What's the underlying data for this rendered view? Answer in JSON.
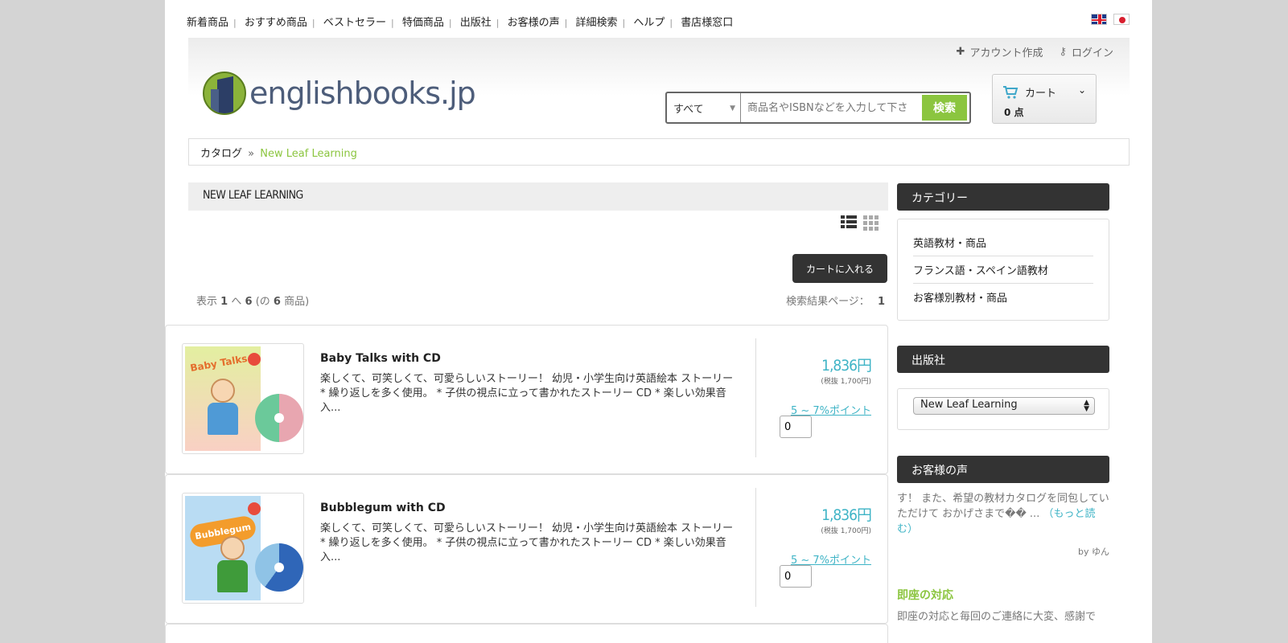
{
  "topnav": [
    "新着商品",
    "おすすめ商品",
    "ベストセラー",
    "特価商品",
    "出版社",
    "お客様の声",
    "詳細検索",
    "ヘルプ",
    "書店様窓口"
  ],
  "account": {
    "create": "アカウント作成",
    "login": "ログイン"
  },
  "logo": {
    "text": "englishbooks.jp"
  },
  "search": {
    "category": "すべて",
    "placeholder": "商品名やISBNなどを入力して下さ",
    "button": "検索"
  },
  "cart": {
    "label": "カート",
    "count": "0 点"
  },
  "breadcrumb": {
    "root": "カタログ",
    "sep": "»",
    "current": "New Leaf Learning"
  },
  "page_title": "NEW LEAF LEARNING",
  "add_to_cart": "カートに入れる",
  "results": {
    "prefix": "表示",
    "from": "1",
    "to_word": "へ",
    "to": "6",
    "of_open": "(の",
    "total": "6",
    "of_close": "商品)",
    "page_label": "検索結果ページ：",
    "page": "1"
  },
  "products": [
    {
      "name": "Baby Talks with CD",
      "cover_title": "Baby Talks",
      "desc": "楽しくて、可笑しくて、可愛らしいストーリー！ 幼児・小学生向け英語絵本 ストーリー * 繰り返しを多く使用。 * 子供の視点に立って書かれたストーリー CD * 楽しい効果音入...",
      "price": "1,836円",
      "price_tax": "(税抜 1,700円)",
      "points": "5 ~ 7%ポイント",
      "qty": "0"
    },
    {
      "name": "Bubblegum with CD",
      "cover_title": "Bubblegum",
      "desc": "楽しくて、可笑しくて、可愛らしいストーリー！ 幼児・小学生向け英語絵本 ストーリー * 繰り返しを多く使用。 * 子供の視点に立って書かれたストーリー CD * 楽しい効果音入...",
      "price": "1,836円",
      "price_tax": "(税抜 1,700円)",
      "points": "5 ~ 7%ポイント",
      "qty": "0"
    }
  ],
  "sidebar": {
    "category_title": "カテゴリー",
    "categories": [
      "英語教材・商品",
      "フランス語・スペイン語教材",
      "お客様別教材・商品"
    ],
    "publisher_title": "出版社",
    "publisher_selected": "New Leaf Learning",
    "testimonial_title": "お客様の声",
    "testimonial_text": "す！ また、希望の教材カタログを同包していただけて おかげさまで�� ...",
    "testimonial_more": "（もっと読む）",
    "testimonial_by": "by ゆん",
    "testimonial2_title": "即座の対応",
    "testimonial2_text": "即座の対応と毎回のご連絡に大変、感謝で"
  },
  "colors": {
    "accent_green": "#8bc53f",
    "accent_teal": "#3fb4c6",
    "dark": "#333333"
  }
}
